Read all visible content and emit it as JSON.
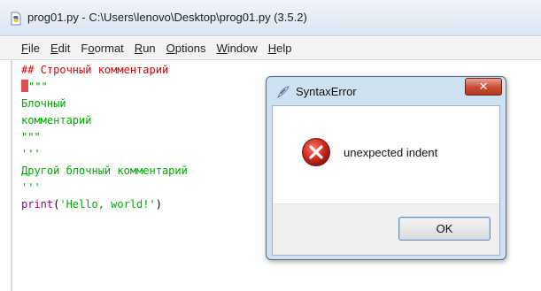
{
  "window": {
    "title": "prog01.py - C:\\Users\\lenovo\\Desktop\\prog01.py (3.5.2)",
    "icon": "python-file-icon"
  },
  "menu": [
    {
      "accel": "F",
      "rest": "ile"
    },
    {
      "accel": "E",
      "rest": "dit"
    },
    {
      "accel": "",
      "pre": "F",
      "rest_after": "ormat",
      "label": "Format"
    },
    {
      "accel": "R",
      "rest": "un"
    },
    {
      "accel": "O",
      "rest": "ptions"
    },
    {
      "accel": "W",
      "rest": "indow"
    },
    {
      "accel": "H",
      "rest": "elp"
    }
  ],
  "editor": {
    "lines": [
      {
        "text": "## Строчный комментарий",
        "color": "#dd0000"
      },
      {
        "text": "\"\"\"",
        "color": "#00aa00",
        "cursor": true
      },
      {
        "text": "Блочный",
        "color": "#00aa00"
      },
      {
        "text": "комментарий",
        "color": "#00aa00"
      },
      {
        "text": "\"\"\"",
        "color": "#00aa00"
      },
      {
        "text": "'''",
        "color": "#00aa00"
      },
      {
        "text": "Другой блочный комментарий",
        "color": "#00aa00"
      },
      {
        "text": "'''",
        "color": "#00aa00"
      },
      {
        "segments": [
          {
            "text": "print",
            "color": "#900090"
          },
          {
            "text": "(",
            "color": "#000000"
          },
          {
            "text": "'Hello, world!'",
            "color": "#00aa00"
          },
          {
            "text": ")",
            "color": "#000000"
          }
        ]
      }
    ]
  },
  "dialog": {
    "title": "SyntaxError",
    "close_label": "✕",
    "message": "unexpected indent",
    "ok_label": "OK",
    "error_color": "#cc1f1f"
  }
}
